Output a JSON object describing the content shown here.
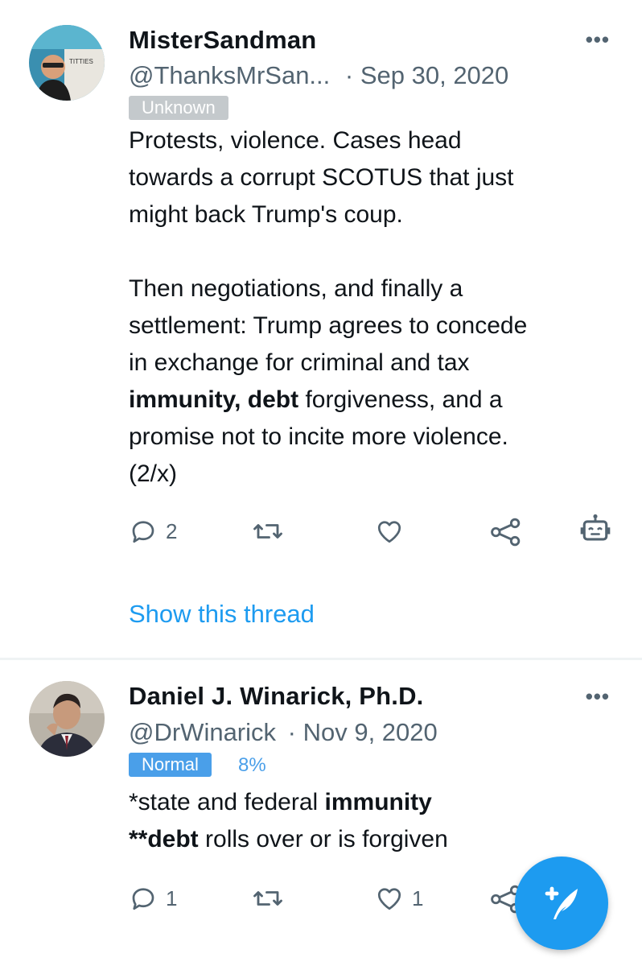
{
  "tweets": [
    {
      "author": "MisterSandman",
      "handle": "@ThanksMrSan...",
      "date": "· Sep 30, 2020",
      "label": "Unknown",
      "lines1": [
        "Protests, violence. Cases head",
        "towards a corrupt SCOTUS that just",
        "might back Trump's coup."
      ],
      "lines2a": [
        "Then negotiations, and finally a",
        "settlement: Trump agrees to concede",
        "in exchange for criminal and tax"
      ],
      "bold1": "immunity, debt",
      "after_bold1": " forgiveness, and a",
      "lines2b": [
        "promise not to incite more violence.",
        "(2/x)"
      ],
      "reply_count": "2",
      "retweet_count": "",
      "like_count": "",
      "show_thread": "Show this thread",
      "avatar_sign": "TITTIES"
    },
    {
      "author": "Daniel J. Winarick, Ph.D.",
      "handle": "@DrWinarick",
      "date": "· Nov 9, 2020",
      "label": "Normal",
      "percent": "8%",
      "line1_pre": "*state and federal ",
      "line1_bold": "immunity",
      "line2_bold": "**debt",
      "line2_post": " rolls over or is forgiven",
      "reply_count": "1",
      "retweet_count": "",
      "like_count": "1"
    }
  ],
  "icons": [
    "more-icon",
    "reply-icon",
    "retweet-icon",
    "like-icon",
    "share-icon",
    "bot-icon",
    "compose-icon"
  ],
  "colors": {
    "accent": "#1d9bf0",
    "badge_normal": "#4a9fe9",
    "badge_unknown": "#c4c9cc",
    "muted": "#536471"
  }
}
